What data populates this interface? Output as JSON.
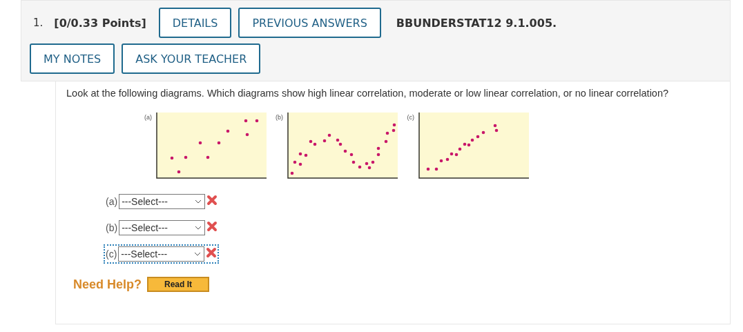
{
  "header": {
    "number": "1.",
    "points": "[0/0.33 Points]",
    "buttons": [
      "DETAILS",
      "PREVIOUS ANSWERS"
    ],
    "source": "BBUNDERSTAT12 9.1.005.",
    "tools": [
      "MY NOTES",
      "ASK YOUR TEACHER"
    ]
  },
  "question": "Look at the following diagrams. Which diagrams show high linear correlation, moderate or low linear correlation, or no linear correlation?",
  "plots": [
    {
      "label": "(a)"
    },
    {
      "label": "(b)"
    },
    {
      "label": "(c)"
    }
  ],
  "answers": [
    {
      "label": "(a)",
      "value": "---Select---",
      "correct": false,
      "focused": false
    },
    {
      "label": "(b)",
      "value": "---Select---",
      "correct": false,
      "focused": false
    },
    {
      "label": "(c)",
      "value": "---Select---",
      "correct": false,
      "focused": true
    }
  ],
  "help": {
    "label": "Need Help?",
    "button": "Read It"
  }
}
